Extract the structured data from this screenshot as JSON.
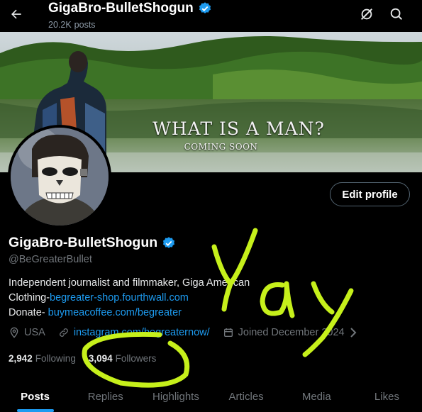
{
  "header": {
    "title": "GigaBro-BulletShogun",
    "post_count": "20.2K",
    "posts_label": "posts"
  },
  "banner": {
    "title_text": "WHAT IS A MAN?",
    "subtitle_text": "COMING SOON"
  },
  "profile": {
    "edit_label": "Edit profile",
    "name": "GigaBro-BulletShogun",
    "handle": "@BeGreaterBullet",
    "bio_line1": "Independent journalist and filmmaker, Giga American",
    "bio_line2_prefix": "Clothing-",
    "bio_line2_link": "begreater-shop.fourthwall.com",
    "bio_line3_prefix": "Donate- ",
    "bio_line3_link": "buymeacoffee.com/begreater",
    "location": "USA",
    "website": "instagram.com/begreaternow/",
    "joined": "Joined December 2024"
  },
  "stats": {
    "following_count": "2,942",
    "following_label": "Following",
    "followers_count": "3,094",
    "followers_label": "Followers"
  },
  "tabs": [
    {
      "label": "Posts"
    },
    {
      "label": "Replies"
    },
    {
      "label": "Highlights"
    },
    {
      "label": "Articles"
    },
    {
      "label": "Media"
    },
    {
      "label": "Likes"
    }
  ],
  "annotation": {
    "scribble_text": "Yay"
  },
  "colors": {
    "accent": "#1d9bf0",
    "verified": "#1d9bf0",
    "scribble": "#c6f01b",
    "background": "#000000"
  },
  "icons": {
    "back": "arrow-left-icon",
    "verified": "verified-badge-icon",
    "grok": "grok-icon",
    "search": "search-icon",
    "location": "location-icon",
    "link": "link-icon",
    "calendar": "calendar-icon",
    "chevron": "chevron-right-icon"
  }
}
